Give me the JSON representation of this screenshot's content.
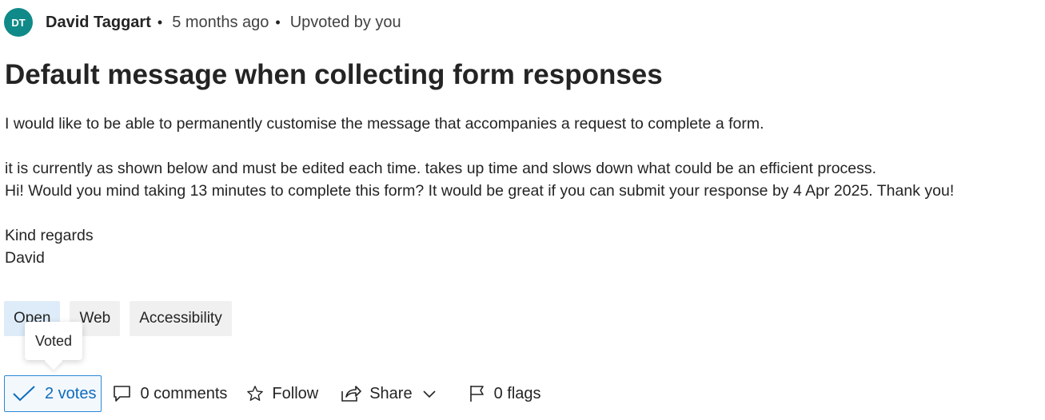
{
  "header": {
    "avatar_initials": "DT",
    "avatar_color": "#0f8a88",
    "author": "David Taggart",
    "separator": "•",
    "time_ago": "5 months ago",
    "vote_status": "Upvoted by you"
  },
  "post": {
    "title": "Default message when collecting form responses",
    "paragraphs": {
      "p1": "I would like to be able to permanently customise the message that accompanies a request to complete a form.",
      "p2": "it is currently as shown below and must be edited each time. takes up time and slows down what could be an efficient process.",
      "p3": "Hi! Would you mind taking 13 minutes to complete this form? It would be great if you can submit your response by 4 Apr 2025. Thank you!",
      "p4": "Kind regards",
      "p5": "David"
    }
  },
  "tags": [
    "Open",
    "Web",
    "Accessibility"
  ],
  "tooltip": {
    "text": "Voted"
  },
  "actions": {
    "votes": "2 votes",
    "comments": "0 comments",
    "follow": "Follow",
    "share": "Share",
    "flags": "0 flags"
  },
  "icons": {
    "vote": "checkmark-icon",
    "comments": "comment-icon",
    "follow": "star-icon",
    "share": "share-icon",
    "share_menu": "chevron-down-icon",
    "flags": "flag-icon"
  },
  "colors": {
    "accent": "#0f6cbd",
    "open_tag": "#deecf9",
    "tag": "#f0f0f0"
  }
}
